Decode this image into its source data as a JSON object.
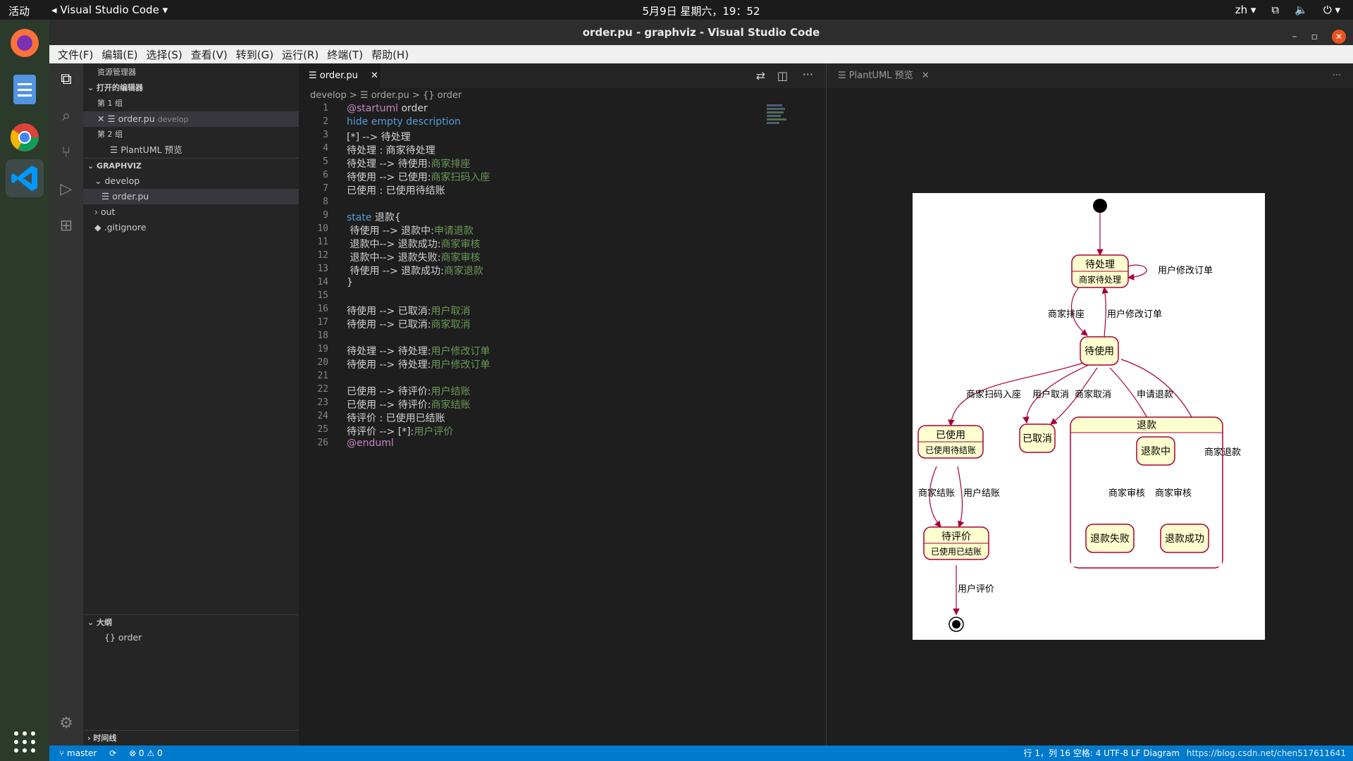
{
  "topbar": {
    "activities": "活动",
    "app_name": "Visual Studio Code",
    "clock": "5月9日 星期六，19：52",
    "lang": "zh"
  },
  "window": {
    "title": "order.pu - graphviz - Visual Studio Code"
  },
  "menu": [
    "文件(F)",
    "编辑(E)",
    "选择(S)",
    "查看(V)",
    "转到(G)",
    "运行(R)",
    "终端(T)",
    "帮助(H)"
  ],
  "sidebar": {
    "title": "资源管理器",
    "open_editors": "打开的编辑器",
    "group1": "第 1 组",
    "open_file": "order.pu",
    "open_file_desc": "develop",
    "group2": "第 2 组",
    "preview_item": "PlantUML 预览",
    "project": "GRAPHVIZ",
    "folder_develop": "develop",
    "file_order": "order.pu",
    "folder_out": "out",
    "file_gitignore": ".gitignore",
    "outline": "大纲",
    "outline_item": "{} order",
    "timeline": "时间线"
  },
  "editor": {
    "tab": "order.pu",
    "breadcrumb": "develop  >  ☰ order.pu  >  {} order",
    "lines": [
      "@startuml order",
      "hide empty description",
      "[*] --> 待处理",
      "待处理 : 商家待处理",
      "待处理 --> 待使用:商家排座",
      "待使用 --> 已使用:商家扫码入座",
      "已使用 : 已使用待结账",
      "",
      "state 退款{",
      " 待使用 --> 退款中:申请退款",
      " 退款中--> 退款成功:商家审核",
      " 退款中--> 退款失败:商家审核",
      " 待使用 --> 退款成功:商家退款",
      "}",
      "",
      "待使用 --> 已取消:用户取消",
      "待使用 --> 已取消:商家取消",
      "",
      "待处理 --> 待处理:用户修改订单",
      "待使用 --> 待处理:用户修改订单",
      "",
      "已使用 --> 待评价:用户结账",
      "已使用 --> 待评价:商家结账",
      "待评价 : 已使用已结账",
      "待评价 --> [*]:用户评价",
      "@enduml"
    ]
  },
  "preview": {
    "tab": "PlantUML 预览",
    "states": {
      "s1": "待处理",
      "s1d": "商家待处理",
      "s2": "待使用",
      "s3": "已使用",
      "s3d": "已使用待结账",
      "s4": "已取消",
      "s5": "待评价",
      "s5d": "已使用已结账",
      "refund": "退款",
      "r1": "退款中",
      "r2": "退款失败",
      "r3": "退款成功"
    },
    "labels": {
      "selfloop": "用户修改订单",
      "a": "商家排座",
      "b": "用户修改订单",
      "c": "商家扫码入座",
      "d": "用户取消",
      "e": "商家取消",
      "f": "申请退款",
      "g": "商家退款",
      "h": "商家结账",
      "i": "用户结账",
      "j": "商家审核",
      "k": "商家审核",
      "l": "用户评价"
    }
  },
  "status": {
    "branch": "master",
    "problems": "⊗ 0 ⚠ 0",
    "right": "行 1，列 16   空格: 4   UTF-8   LF   Diagram",
    "watermark": "https://blog.csdn.net/chen517611641"
  }
}
